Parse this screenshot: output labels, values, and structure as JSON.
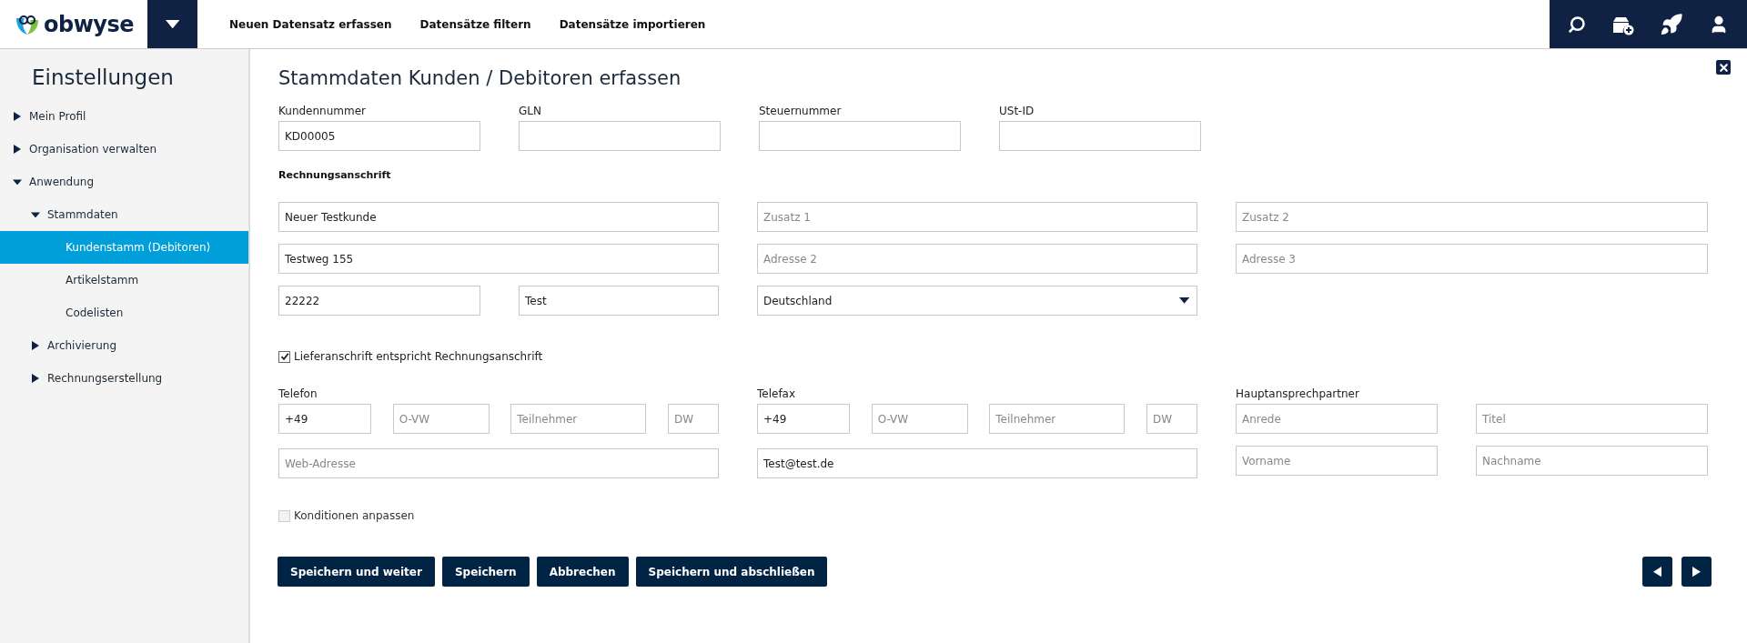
{
  "topbar": {
    "logo": "obwyse",
    "nav": [
      "Neuen Datensatz erfassen",
      "Datensätze filtern",
      "Datensätze importieren"
    ]
  },
  "sidebar": {
    "title": "Einstellungen",
    "items": [
      {
        "label": "Mein Profil",
        "expanded": false,
        "selected": false
      },
      {
        "label": "Organisation verwalten",
        "expanded": false,
        "selected": false
      },
      {
        "label": "Anwendung",
        "expanded": true,
        "selected": false,
        "children": [
          {
            "label": "Stammdaten",
            "expanded": true,
            "selected": false,
            "children": [
              {
                "label": "Kundenstamm (Debitoren)",
                "selected": true
              },
              {
                "label": "Artikelstamm",
                "selected": false
              },
              {
                "label": "Codelisten",
                "selected": false
              }
            ]
          },
          {
            "label": "Archivierung",
            "expanded": false,
            "selected": false
          },
          {
            "label": "Rechnungserstellung",
            "expanded": false,
            "selected": false
          }
        ]
      }
    ]
  },
  "form": {
    "title": "Stammdaten Kunden / Debitoren erfassen",
    "id_fields": [
      {
        "label": "Kundennummer",
        "value": "KD00005"
      },
      {
        "label": "GLN"
      },
      {
        "label": "Steuernummer"
      },
      {
        "label": "USt-ID"
      }
    ],
    "billing_heading": "Rechnungsanschrift",
    "address_rows": [
      [
        [
          {
            "kind": "input",
            "value": "Neuer Testkunde"
          }
        ],
        [
          {
            "kind": "input",
            "placeholder": "Zusatz 1"
          }
        ],
        [
          {
            "kind": "input",
            "placeholder": "Zusatz 2"
          }
        ]
      ],
      [
        [
          {
            "kind": "input",
            "value": "Testweg 155"
          }
        ],
        [
          {
            "kind": "input",
            "placeholder": "Adresse 2"
          }
        ],
        [
          {
            "kind": "input",
            "placeholder": "Adresse 3"
          }
        ]
      ],
      [
        [
          {
            "kind": "input",
            "value": "22222"
          },
          {
            "kind": "input",
            "value": "Test"
          }
        ],
        [
          {
            "kind": "select",
            "value": "Deutschland"
          }
        ]
      ]
    ],
    "delivery_same": {
      "label": "Lieferanschrift entspricht Rechnungsanschrift",
      "checked": true,
      "disabled": false
    },
    "communication": [
      {
        "kind": "phone",
        "label": "Telefon",
        "fields": [
          {
            "value": "+49"
          },
          {
            "placeholder": "O-VW"
          },
          {
            "placeholder": "Teilnehmer"
          },
          {
            "placeholder": "DW"
          }
        ],
        "wide_field": {
          "placeholder": "Web-Adresse"
        }
      },
      {
        "kind": "phone",
        "label": "Telefax",
        "fields": [
          {
            "value": "+49"
          },
          {
            "placeholder": "O-VW"
          },
          {
            "placeholder": "Teilnehmer"
          },
          {
            "placeholder": "DW"
          }
        ],
        "wide_field": {
          "value": "Test@test.de"
        }
      },
      {
        "kind": "contact",
        "label": "Hauptansprechpartner",
        "fields": [
          {
            "placeholder": "Anrede"
          },
          {
            "placeholder": "Titel"
          },
          {
            "placeholder": "Vorname"
          },
          {
            "placeholder": "Nachname"
          }
        ]
      }
    ],
    "conditions": {
      "label": "Konditionen anpassen",
      "checked": false,
      "disabled": true
    },
    "buttons": [
      "Speichern und weiter",
      "Speichern",
      "Abbrechen",
      "Speichern und abschließen"
    ]
  }
}
